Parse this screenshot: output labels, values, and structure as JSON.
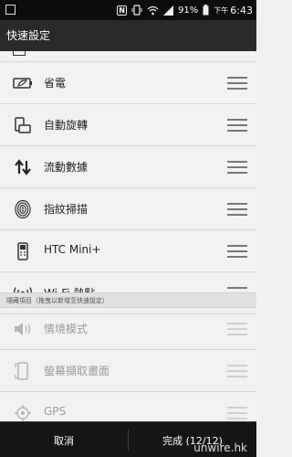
{
  "status_bar": {
    "battery_percent": "91%",
    "time_prefix": "下午",
    "time": "6:43",
    "nfc_label": "N"
  },
  "title": "快速設定",
  "active_items": [
    {
      "label": "省電",
      "icon": "battery-saver-icon"
    },
    {
      "label": "自動旋轉",
      "icon": "rotate-icon"
    },
    {
      "label": "流動數據",
      "icon": "data-arrows-icon"
    },
    {
      "label": "指紋掃描",
      "icon": "fingerprint-icon"
    },
    {
      "label": "HTC Mini+",
      "icon": "mini-remote-icon"
    },
    {
      "label": "Wi-Fi 熱點",
      "icon": "wifi-hotspot-icon"
    }
  ],
  "hidden_section_label": "隱藏項目（拖曳以新增至快速設定）",
  "hidden_items": [
    {
      "label": "情境模式",
      "icon": "speaker-icon"
    },
    {
      "label": "螢幕擷取畫面",
      "icon": "screenshot-icon"
    },
    {
      "label": "GPS",
      "icon": "gps-icon"
    }
  ],
  "bottom_bar": {
    "cancel_label": "取消",
    "done_label": "完成 (12/12)"
  },
  "watermark": "unwire.hk"
}
